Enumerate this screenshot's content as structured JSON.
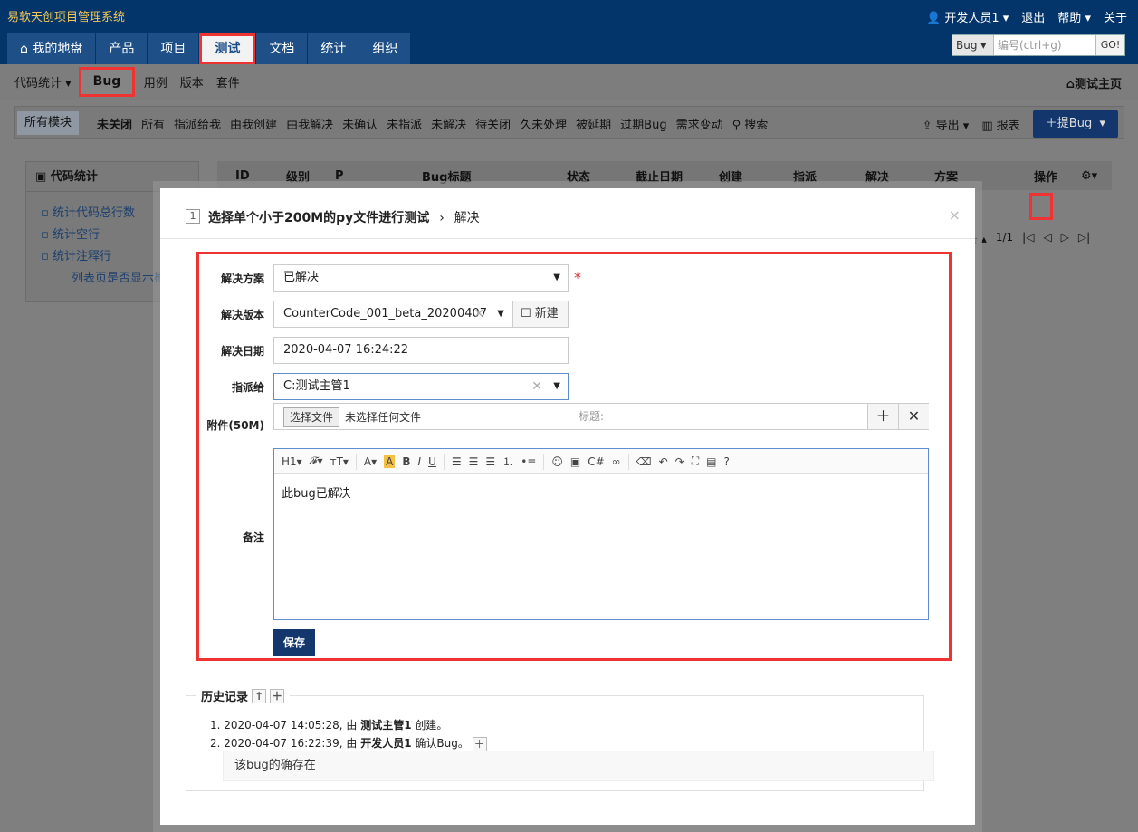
{
  "app": {
    "logo": "易软天创项目管理系统",
    "user_menu": "开发人员1",
    "logout": "退出",
    "help": "帮助",
    "about": "关于"
  },
  "nav": {
    "tabs": [
      "我的地盘",
      "产品",
      "项目",
      "测试",
      "文档",
      "统计",
      "组织"
    ],
    "active": "测试"
  },
  "search": {
    "type": "Bug",
    "placeholder": "编号(ctrl+g)",
    "go": "GO!"
  },
  "subnav": {
    "items": [
      "代码统计",
      "Bug",
      "用例",
      "版本",
      "套件"
    ],
    "active": "Bug",
    "home": "测试主页"
  },
  "filters": {
    "module": "所有模块",
    "items": [
      "未关闭",
      "所有",
      "指派给我",
      "由我创建",
      "由我解决",
      "未确认",
      "未指派",
      "未解决",
      "待关闭",
      "久未处理",
      "被延期",
      "过期Bug",
      "需求变动",
      "搜索"
    ],
    "export": "导出",
    "report": "报表",
    "add_bug": "提Bug"
  },
  "sidepanel": {
    "title": "代码统计",
    "links": [
      "统计代码总行数",
      "统计空行",
      "统计注释行"
    ],
    "note": "列表页是否显示模"
  },
  "table": {
    "headers": [
      "ID",
      "级别",
      "P",
      "Bug标题",
      "状态",
      "截止日期",
      "创建",
      "指派",
      "解决",
      "方案",
      "操作"
    ],
    "pager": "条 ▴",
    "page": "1/1"
  },
  "modal": {
    "number": "1",
    "bug_title": "选择单个小于200M的py文件进行测试",
    "action": "解决",
    "close": "×",
    "form": {
      "resolution_label": "解决方案",
      "resolution_value": "已解决",
      "build_label": "解决版本",
      "build_value": "CounterCode_001_beta_20200407",
      "new_label": "新建",
      "date_label": "解决日期",
      "date_value": "2020-04-07 16:24:22",
      "assign_label": "指派给",
      "assign_value": "C:测试主管1",
      "files_label": "附件(50M)",
      "choose_file": "选择文件",
      "no_file": "未选择任何文件",
      "title_placeholder": "标题:",
      "comment_label": "备注",
      "comment_value": "此bug已解决",
      "save": "保存"
    },
    "history": {
      "title": "历史记录",
      "entries": [
        {
          "index": "1.",
          "time": "2020-04-07 14:05:28, 由",
          "user": "测试主管1",
          "action": "创建。"
        },
        {
          "index": "2.",
          "time": "2020-04-07 16:22:39, 由",
          "user": "开发人员1",
          "action": "确认Bug。"
        }
      ],
      "comment": "该bug的确存在"
    }
  }
}
